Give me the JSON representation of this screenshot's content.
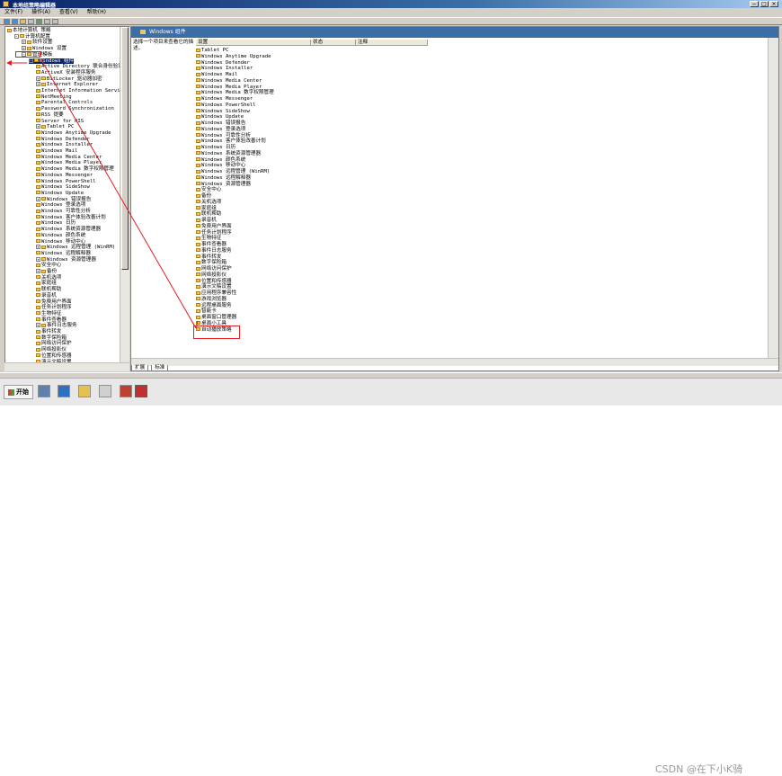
{
  "window": {
    "title": "本地组策略编辑器"
  },
  "menu": [
    "文件(F)",
    "操作(A)",
    "查看(V)",
    "帮助(H)"
  ],
  "tree": [
    {
      "label": "本地计算机 策略",
      "indent": 0,
      "exp": ""
    },
    {
      "label": "计算机配置",
      "indent": 1,
      "exp": "−"
    },
    {
      "label": "软件设置",
      "indent": 2,
      "exp": "+"
    },
    {
      "label": "Windows 设置",
      "indent": 2,
      "exp": "+"
    },
    {
      "label": "管理模板",
      "indent": 2,
      "exp": "−"
    },
    {
      "label": "Windows 组件",
      "indent": 3,
      "exp": "−"
    },
    {
      "label": "Active Directory 联合身份验证服",
      "indent": 4,
      "exp": ""
    },
    {
      "label": "ActiveX 安装程序服务",
      "indent": 4,
      "exp": ""
    },
    {
      "label": "BitLocker 驱动器加密",
      "indent": 4,
      "exp": "+"
    },
    {
      "label": "Internet Explorer",
      "indent": 4,
      "exp": "+"
    },
    {
      "label": "Internet Information Services",
      "indent": 4,
      "exp": ""
    },
    {
      "label": "NetMeeting",
      "indent": 4,
      "exp": ""
    },
    {
      "label": "Parental Controls",
      "indent": 4,
      "exp": ""
    },
    {
      "label": "Password Synchronization",
      "indent": 4,
      "exp": ""
    },
    {
      "label": "RSS 提要",
      "indent": 4,
      "exp": ""
    },
    {
      "label": "Server for NIS",
      "indent": 4,
      "exp": ""
    },
    {
      "label": "Tablet PC",
      "indent": 4,
      "exp": "+"
    },
    {
      "label": "Windows Anytime Upgrade",
      "indent": 4,
      "exp": ""
    },
    {
      "label": "Windows Defender",
      "indent": 4,
      "exp": ""
    },
    {
      "label": "Windows Installer",
      "indent": 4,
      "exp": ""
    },
    {
      "label": "Windows Mail",
      "indent": 4,
      "exp": ""
    },
    {
      "label": "Windows Media Center",
      "indent": 4,
      "exp": ""
    },
    {
      "label": "Windows Media Player",
      "indent": 4,
      "exp": ""
    },
    {
      "label": "Windows Media 数字权限管理",
      "indent": 4,
      "exp": ""
    },
    {
      "label": "Windows Messenger",
      "indent": 4,
      "exp": ""
    },
    {
      "label": "Windows PowerShell",
      "indent": 4,
      "exp": ""
    },
    {
      "label": "Windows SideShow",
      "indent": 4,
      "exp": ""
    },
    {
      "label": "Windows Update",
      "indent": 4,
      "exp": ""
    },
    {
      "label": "Windows 错误报告",
      "indent": 4,
      "exp": "+"
    },
    {
      "label": "Windows 登录选项",
      "indent": 4,
      "exp": ""
    },
    {
      "label": "Windows 可靠性分析",
      "indent": 4,
      "exp": ""
    },
    {
      "label": "Windows 客户体验改善计划",
      "indent": 4,
      "exp": ""
    },
    {
      "label": "Windows 日历",
      "indent": 4,
      "exp": ""
    },
    {
      "label": "Windows 系统资源管理器",
      "indent": 4,
      "exp": ""
    },
    {
      "label": "Windows 颜色系统",
      "indent": 4,
      "exp": ""
    },
    {
      "label": "Windows 移动中心",
      "indent": 4,
      "exp": ""
    },
    {
      "label": "Windows 远程管理 (WinRM)",
      "indent": 4,
      "exp": "+"
    },
    {
      "label": "Windows 远程解释器",
      "indent": 4,
      "exp": ""
    },
    {
      "label": "Windows 资源管理器",
      "indent": 4,
      "exp": "+"
    },
    {
      "label": "安全中心",
      "indent": 4,
      "exp": ""
    },
    {
      "label": "备份",
      "indent": 4,
      "exp": "+"
    },
    {
      "label": "关机选项",
      "indent": 4,
      "exp": ""
    },
    {
      "label": "家庭组",
      "indent": 4,
      "exp": ""
    },
    {
      "label": "联机帮助",
      "indent": 4,
      "exp": ""
    },
    {
      "label": "录音机",
      "indent": 4,
      "exp": ""
    },
    {
      "label": "免费用户界面",
      "indent": 4,
      "exp": ""
    },
    {
      "label": "任务计划程序",
      "indent": 4,
      "exp": ""
    },
    {
      "label": "生物特征",
      "indent": 4,
      "exp": ""
    },
    {
      "label": "事件查看器",
      "indent": 4,
      "exp": ""
    },
    {
      "label": "事件日志服务",
      "indent": 4,
      "exp": "+"
    },
    {
      "label": "事件转发",
      "indent": 4,
      "exp": ""
    },
    {
      "label": "数字保险箱",
      "indent": 4,
      "exp": ""
    },
    {
      "label": "网络访问保护",
      "indent": 4,
      "exp": ""
    },
    {
      "label": "网络投影仪",
      "indent": 4,
      "exp": ""
    },
    {
      "label": "位置和传感器",
      "indent": 4,
      "exp": ""
    },
    {
      "label": "演示文稿设置",
      "indent": 4,
      "exp": ""
    }
  ],
  "right": {
    "header": "Windows 组件",
    "description": "选择一个项目来查看它的描述。",
    "columns": [
      "设置",
      "状态",
      "注释"
    ],
    "items": [
      "Tablet PC",
      "Windows Anytime Upgrade",
      "Windows Defender",
      "Windows Installer",
      "Windows Mail",
      "Windows Media Center",
      "Windows Media Player",
      "Windows Media 数字权限管理",
      "Windows Messenger",
      "Windows PowerShell",
      "Windows SideShow",
      "Windows Update",
      "Windows 错误报告",
      "Windows 登录选项",
      "Windows 可靠性分析",
      "Windows 客户体验改善计划",
      "Windows 日历",
      "Windows 系统资源管理器",
      "Windows 颜色系统",
      "Windows 移动中心",
      "Windows 远程管理 (WinRM)",
      "Windows 远程解释器",
      "Windows 资源管理器",
      "安全中心",
      "备份",
      "关机选项",
      "家庭组",
      "联机帮助",
      "录音机",
      "免费用户界面",
      "任务计划程序",
      "生物特征",
      "事件查看器",
      "事件日志服务",
      "事件转发",
      "数字保险箱",
      "网络访问保护",
      "网络投影仪",
      "位置和传感器",
      "演示文稿设置",
      "应用程序兼容性",
      "游戏浏览器",
      "远程桌面服务",
      "智能卡",
      "桌面窗口管理器",
      "桌面小工具",
      "自动播放策略"
    ],
    "highlighted_item": "远程桌面服务"
  },
  "tabs": [
    "扩展",
    "标准"
  ],
  "taskbar": {
    "start_label": "开始"
  },
  "watermark": "CSDN @在下小K骑",
  "colors": {
    "title_bar": "#0a246a",
    "header": "#3a6ea5",
    "annotation": "#e02020",
    "folder": "#f0c850"
  }
}
